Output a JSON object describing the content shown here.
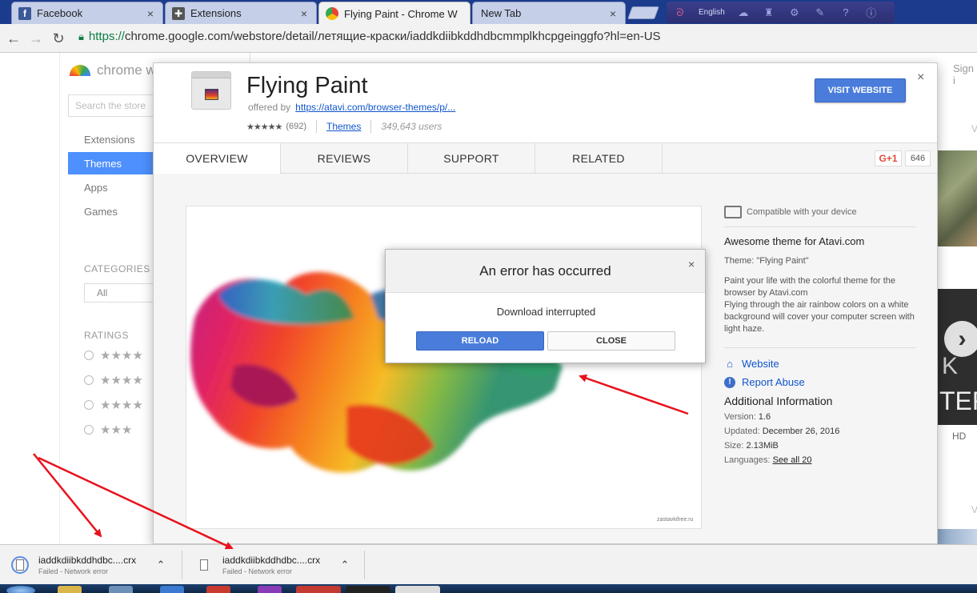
{
  "tabs": [
    {
      "title": "Facebook",
      "icon": "facebook-icon",
      "active": false
    },
    {
      "title": "Extensions",
      "icon": "puzzle-icon",
      "active": false
    },
    {
      "title": "Flying Paint - Chrome W",
      "icon": "chrome-webstore-icon",
      "active": true
    },
    {
      "title": "New Tab",
      "icon": "",
      "active": false
    }
  ],
  "extension_bar": {
    "language": "English"
  },
  "address_bar": {
    "scheme": "https://",
    "host_path": "chrome.google.com/webstore/detail/летящие-краски/iaddkdiibkddhdbcmmplkhcpgeinggfo?hl=en-US"
  },
  "store": {
    "logo_text": "chrome w",
    "search_placeholder": "Search the store",
    "nav": [
      "Extensions",
      "Themes",
      "Apps",
      "Games"
    ],
    "active_nav": "Themes",
    "categories_heading": "CATEGORIES",
    "categories_value": "All",
    "ratings_heading": "RATINGS",
    "ratings": [
      "★★★★",
      "★★★★",
      "★★★★",
      "★★★"
    ],
    "signin": "Sign i",
    "right_panel": {
      "v1": "V",
      "txt1": "K",
      "txt2": "TERI",
      "hd": "HD",
      "v2": "V"
    }
  },
  "detail": {
    "title": "Flying Paint",
    "offered_by_label": "offered by",
    "offered_by_url": "https://atavi.com/browser-themes/p/...",
    "stars": "★★★★★",
    "rating_count": "(692)",
    "category": "Themes",
    "users": "349,643 users",
    "visit_button": "VISIT WEBSITE",
    "close": "×",
    "tabs": [
      "OVERVIEW",
      "REVIEWS",
      "SUPPORT",
      "RELATED"
    ],
    "active_tab": "OVERVIEW",
    "gplus": "G+1",
    "gplus_count": "646",
    "screenshot_watermark": "zastavkifree.ru"
  },
  "info": {
    "compatible": "Compatible with your device",
    "title": "Awesome theme for Atavi.com",
    "theme_name": "Theme: \"Flying Paint\"",
    "description_1": "Paint your life with the colorful theme for the browser by Atavi.com",
    "description_2": "Flying through the air rainbow colors on a white background will cover your computer screen with light haze.",
    "website": "Website",
    "report_abuse": "Report Abuse",
    "additional_heading": "Additional Information",
    "version_label": "Version:",
    "version": "1.6",
    "updated_label": "Updated:",
    "updated": "December 26, 2016",
    "size_label": "Size:",
    "size": "2.13MiB",
    "languages_label": "Languages:",
    "languages": "See all 20"
  },
  "error_dialog": {
    "title": "An error has occurred",
    "message": "Download interrupted",
    "reload": "RELOAD",
    "close": "CLOSE",
    "close_x": "×"
  },
  "downloads": [
    {
      "name": "iaddkdiibkddhdbc....crx",
      "status": "Failed - Network error"
    },
    {
      "name": "iaddkdiibkddhdbc....crx",
      "status": "Failed - Network error"
    }
  ],
  "colors": {
    "accent_blue": "#4a7ddb",
    "annotation_red": "#e8121c",
    "tabstrip": "#1b3b8c"
  }
}
